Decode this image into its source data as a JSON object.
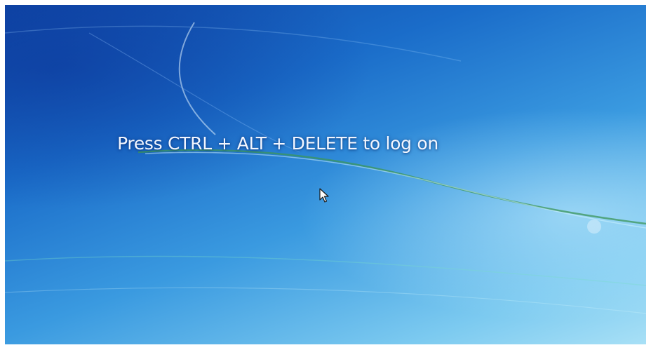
{
  "login_screen": {
    "message": "Press CTRL + ALT + DELETE to log on"
  },
  "colors": {
    "background_dark": "#1048a8",
    "background_light": "#a8e0f6",
    "text": "#f2f6ff"
  },
  "icons": {
    "cursor": "mouse-pointer-arrow"
  }
}
